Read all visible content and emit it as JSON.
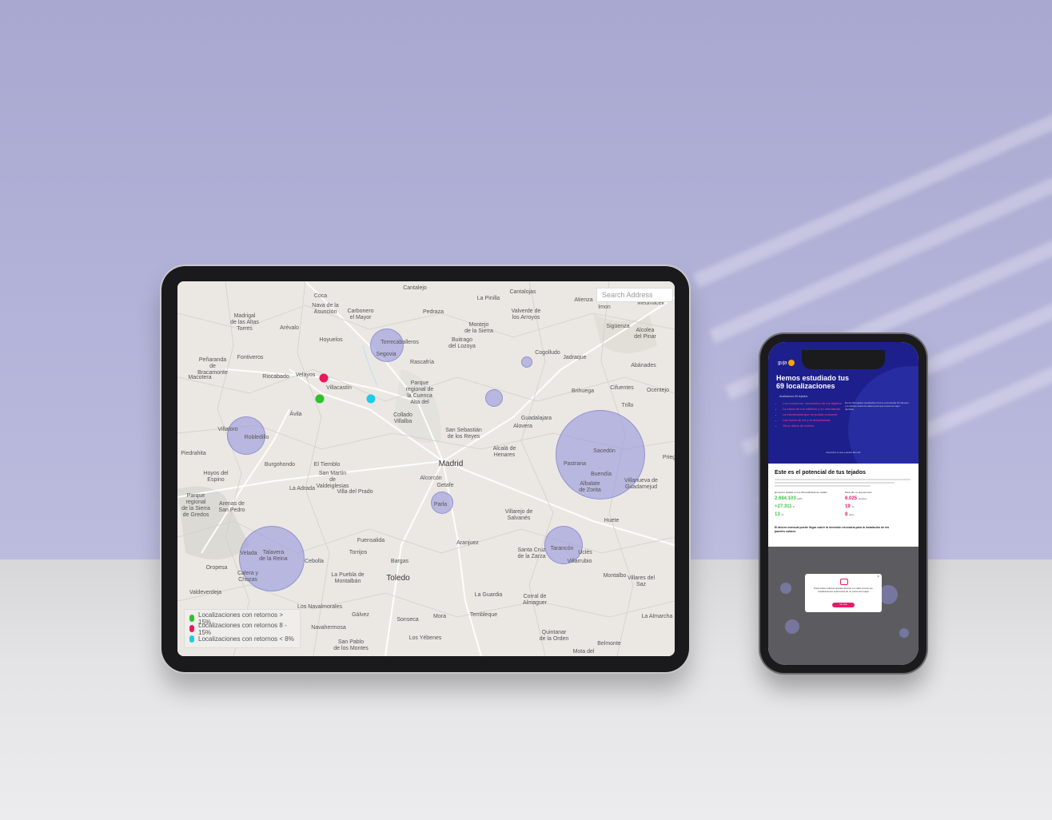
{
  "colors": {
    "wall": "#b0b0d6",
    "bubble": "#9696dc",
    "pin_green": "#2bc12f",
    "pin_pink": "#e8185d",
    "pin_cyan": "#1ecbe8",
    "brand_blue": "#1d1f8c",
    "brand_pink": "#ea1a6a"
  },
  "tablet": {
    "search": {
      "placeholder": "Search Address"
    },
    "legend": [
      {
        "label": "Localizaciones con retornos > 15%",
        "color": "#2bc12f"
      },
      {
        "label": "Localizaciones con retornos 8 - 15%",
        "color": "#e8185d"
      },
      {
        "label": "Localizaciones con retornos < 8%",
        "color": "#1ecbe8"
      }
    ],
    "map_labels": {
      "cantalejo": "Cantalejo",
      "cantalojas": "Cantalojas",
      "coca": "Coca",
      "la_pinilla": "La Pinilla",
      "atienza": "Atienza",
      "imon": "Imon",
      "medinaceli": "Medinaceli",
      "nava": "Nava de la\nAsunción",
      "carbonero": "Carbonero\nel Mayor",
      "pedraza": "Pedraza",
      "valverde": "Valverde de\nlos Arroyos",
      "madrigal": "Madrigal\nde las Altas\nTorres",
      "arevalo": "Arévalo",
      "montejo": "Montejo\nde la Sierra",
      "siguenza": "Sigüenza",
      "alcolea": "Alcolea\ndel Pinar",
      "hoyuelos": "Hoyuelos",
      "torrecaballeros": "Torrecaballeros",
      "segovia": "Segovia",
      "buitrago": "Buitrago\ndel Lozoya",
      "cogolludo": "Cogolludo",
      "jadraque": "Jadraque",
      "penaranda": "Peñaranda\nde\nBracamonte",
      "fontiveros": "Fontiveros",
      "rascafria": "Rascafría",
      "abanades": "Abánades",
      "macotera": "Macotera",
      "riocabado": "Riocabado",
      "velayos": "Velayos",
      "villacastin": "Villacastín",
      "parque": "Parque\nregional de\nla Cuenca\nAlta del",
      "cifuentes": "Cifuentes",
      "ocentejo": "Ocentejo",
      "brihuega": "Brihuega",
      "avila": "Ávila",
      "collado": "Collado\nVillalba",
      "trillo": "Trillo",
      "villatoro": "Villatoro",
      "robledillo": "Robledillo",
      "guadalajara": "Guadalajara",
      "alovera": "Alovera",
      "san_sebastian": "San Sebastián\nde los Reyes",
      "sacedon": "Sacedón",
      "piedrahita": "Piedrahita",
      "alcala": "Alcalá de\nHenares",
      "priego": "Prieg",
      "burgohondo": "Burgohondo",
      "eltiemblo": "El Tiemblo",
      "madrid": "Madrid",
      "pastrana": "Pastrana",
      "hoyos": "Hoyos del\nEspino",
      "san_martin": "San Martín\nde\nValdeiglesias",
      "alcorcon": "Alcorcón",
      "getafe": "Getafe",
      "buendia": "Buendía",
      "parque_gredos": "Parque\nregional\nde la Sierra\nde Gredos",
      "laradra": "La Adrada",
      "villa_prado": "Villa del Prado",
      "albalate": "Albalate\nde Zorita",
      "villanueva": "Villanueva de\nGuadamejud",
      "arenas": "Arenas de\nSan Pedro",
      "parla": "Parla",
      "villarejo": "Villarejo de\nSalvanés",
      "huete": "Huete",
      "fuensalida": "Fuensalida",
      "tarancon": "Tarancón",
      "velada": "Velada",
      "talavera": "Talavera\nde la Reina",
      "cebolla": "Cebolla",
      "torrijos": "Torrijos",
      "aranjuez": "Aranjuez",
      "santa_cruz": "Santa Cruz\nde la Zarza",
      "ucles": "Uclés",
      "villarrubio": "Villarrubio",
      "oropesa": "Oropesa",
      "bargas": "Bargas",
      "calera": "Calera y\nChozas",
      "montalbo": "Montalbo",
      "puebla": "La Puebla de\nMontalbán",
      "toledo": "Toledo",
      "valdeverdeja": "Valdeverdeja",
      "villares": "Villares del\nSaz",
      "guardia": "La Guardia",
      "corral": "Corral de\nAlmaguer",
      "navalmorales": "Los Navalmorales",
      "galvez": "Gálvez",
      "navahermosa": "Navahermosa",
      "sonseca": "Sonseca",
      "mora": "Mora",
      "tembleque": "Tembleque",
      "almarcha": "La Almarcha",
      "yebenes": "Los Yébenes",
      "quintanar": "Quintanar\nde la Orden",
      "belmonte": "Belmonte",
      "san_pablo": "San Pablo\nde los Montes",
      "mota": "Mota del"
    }
  },
  "phone": {
    "logo": "guja",
    "hero_title": "Hemos estudiado tus\n69 localizaciones",
    "hero_sub": "Analizamos 69 tejados",
    "hero_list": [
      "Los consumos, vinculación de los tejados",
      "La altura de tus edificios y su orientación",
      "La electricidad que se podría consumir",
      "Las horas de sol y la temperatura",
      "Otros datos de interés"
    ],
    "hero_text": "De los 69 tejados estudiados hemos encontrado 54 idóneos y te damos todos los datos para que tomes la mejor decisión.",
    "hero_note": "Descubre lo que puedes ahorrar",
    "section_title": "Este es el potencial de tus tejados",
    "col1_head": "El retorno posible en tus 69 localizaciones totales",
    "col1_v1": "2.684.103",
    "col1_u1": "kWh",
    "col1_v2": "+27.311",
    "col1_u2": "€",
    "col1_v3": "13",
    "col1_u3": "% ",
    "col2_head": "Para ello, te proponemos",
    "col2_v1": "6.025",
    "col2_u1": "paneles",
    "col2_v2": "19",
    "col2_u2": "% ",
    "col2_v3": "8",
    "col2_u3": "años",
    "footer_text": "El ahorro mensual puede llegar cubrir la inversión necesaria para la instalación de los paneles solares",
    "modal_text": "Para evitar cuántos puedes ahorrar en cada una de tus localizaciones selecciona de un punto del mapa",
    "modal_button": "Ver más",
    "modal_close": "×"
  }
}
